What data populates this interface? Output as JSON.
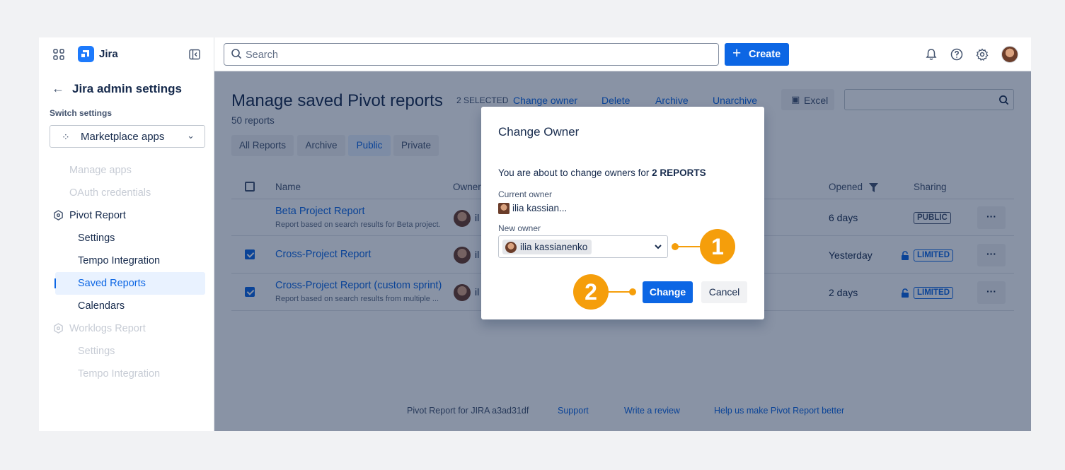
{
  "sidebar": {
    "app_name": "Jira",
    "back_title": "Jira admin settings",
    "switch_label": "Switch settings",
    "switch_value": "Marketplace apps",
    "items": [
      {
        "label": "Manage apps"
      },
      {
        "label": "OAuth credentials"
      },
      {
        "label": "Pivot Report"
      },
      {
        "label": "Settings"
      },
      {
        "label": "Tempo Integration"
      },
      {
        "label": "Saved Reports"
      },
      {
        "label": "Calendars"
      },
      {
        "label": "Worklogs Report"
      },
      {
        "label": "Settings"
      },
      {
        "label": "Tempo Integration"
      }
    ]
  },
  "topbar": {
    "search_placeholder": "Search",
    "create_label": "Create"
  },
  "main": {
    "title": "Manage saved Pivot reports",
    "count": "50 reports",
    "selected": "2 SELECTED",
    "actions": [
      "Change owner",
      "Delete",
      "Archive",
      "Unarchive"
    ],
    "excel_label": "Excel",
    "tabs": [
      "All Reports",
      "Archive",
      "Public",
      "Private"
    ],
    "columns": {
      "name": "Name",
      "owner": "Owner",
      "opened": "Opened",
      "sharing": "Sharing"
    },
    "rows": [
      {
        "name": "Beta Project Report",
        "desc": "Report based on search results for Beta project.",
        "owner": "il",
        "opened": "6 days",
        "sharing": "PUBLIC",
        "checked": false
      },
      {
        "name": "Cross-Project Report",
        "desc": "",
        "owner": "il",
        "opened": "Yesterday",
        "sharing": "LIMITED",
        "checked": true
      },
      {
        "name": "Cross-Project Report (custom sprint)",
        "desc": "Report based on search results from multiple ...",
        "owner": "il",
        "opened": "2 days",
        "sharing": "LIMITED",
        "checked": true
      }
    ],
    "more_label": "···"
  },
  "footer": {
    "version": "Pivot Report for JIRA a3ad31df",
    "support": "Support",
    "review": "Write a review",
    "help": "Help us make Pivot Report better"
  },
  "modal": {
    "title": "Change Owner",
    "text_prefix": "You are about to change owners for ",
    "text_bold": "2 REPORTS",
    "current_owner_label": "Current owner",
    "current_owner": "ilia kassian...",
    "new_owner_label": "New owner",
    "new_owner": "ilia kassianenko",
    "change_label": "Change",
    "cancel_label": "Cancel"
  },
  "callouts": {
    "one": "1",
    "two": "2"
  },
  "colors": {
    "accent": "#0c66e4",
    "callout": "#f59e0b",
    "overlay": "rgba(9,30,66,0.48)"
  }
}
